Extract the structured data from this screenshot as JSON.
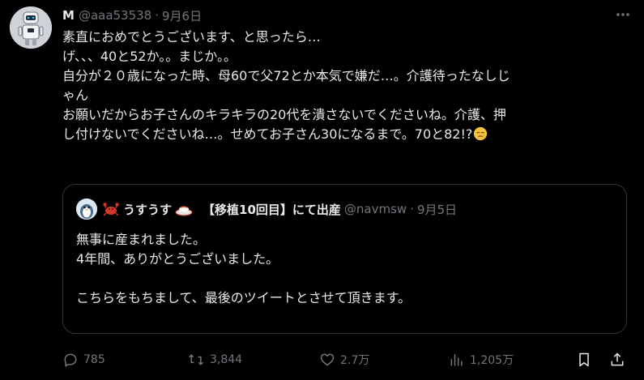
{
  "tweet": {
    "author": {
      "display_name": "M",
      "handle": "@aaa53538",
      "separator": "·",
      "date": "9月6日",
      "avatar_icon": "robot-avatar"
    },
    "lines": [
      "素直におめでとうございます、と思ったら…",
      "げ、、、40と52か。。まじか。。",
      "自分が２０歳になった時、母60で父72とか本気で嫌だ…。介護待ったなしじ",
      "ゃん",
      "お願いだからお子さんのキラキラの20代を潰さないでくださいね。介護、押",
      "し付けないでくださいね…。せめてお子さん30になるまで。70と82!?"
    ],
    "trailing_emoji": "sleepy-face-emoji"
  },
  "quote": {
    "crab_emoji": "crab-emoji",
    "name_text": "うすうす",
    "sushi_emoji": "sushi-plate-emoji",
    "title": "【移植10回目】にて出産",
    "handle": "@navmsw",
    "separator": "·",
    "date": "9月5日",
    "lines": [
      "無事に産まれました。",
      "4年間、ありがとうございました。",
      "",
      "こちらをもちまして、最後のツイートとさせて頂きます。"
    ]
  },
  "actions": {
    "reply_count": "785",
    "repost_count": "3,844",
    "like_count": "2.7万",
    "views_count": "1,205万"
  },
  "colors": {
    "background": "#000000",
    "text": "#e7e9ea",
    "muted": "#71767b",
    "border": "#2f3336"
  }
}
